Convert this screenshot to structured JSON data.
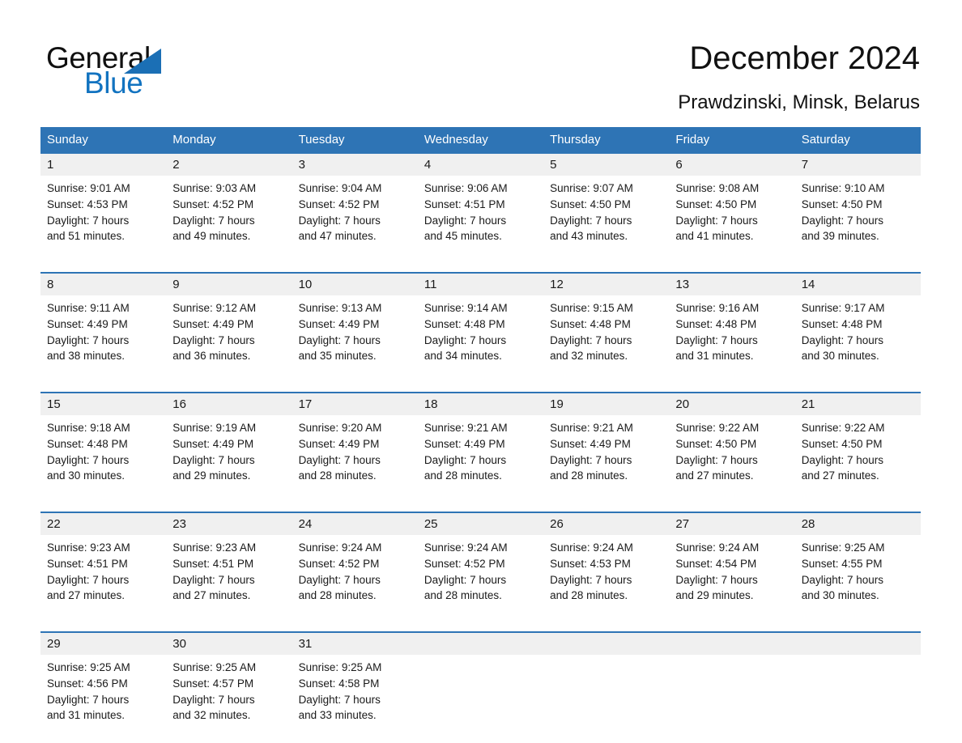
{
  "brand": {
    "name_part1": "General",
    "name_part2": "Blue",
    "triangle_icon": "blue-triangle-icon",
    "accent_color": "#1b6fb5"
  },
  "header": {
    "title": "December 2024",
    "subtitle": "Prawdzinski, Minsk, Belarus"
  },
  "theme": {
    "header_bar_color": "#2e74b5",
    "date_band_color": "#f0f0f0",
    "row_divider_color": "#2e74b5",
    "text_color": "#1a1a1a"
  },
  "calendar": {
    "weekday_headers": [
      "Sunday",
      "Monday",
      "Tuesday",
      "Wednesday",
      "Thursday",
      "Friday",
      "Saturday"
    ],
    "weeks": [
      {
        "days": [
          {
            "date": "1",
            "sunrise": "Sunrise: 9:01 AM",
            "sunset": "Sunset: 4:53 PM",
            "daylight_line1": "Daylight: 7 hours",
            "daylight_line2": "and 51 minutes."
          },
          {
            "date": "2",
            "sunrise": "Sunrise: 9:03 AM",
            "sunset": "Sunset: 4:52 PM",
            "daylight_line1": "Daylight: 7 hours",
            "daylight_line2": "and 49 minutes."
          },
          {
            "date": "3",
            "sunrise": "Sunrise: 9:04 AM",
            "sunset": "Sunset: 4:52 PM",
            "daylight_line1": "Daylight: 7 hours",
            "daylight_line2": "and 47 minutes."
          },
          {
            "date": "4",
            "sunrise": "Sunrise: 9:06 AM",
            "sunset": "Sunset: 4:51 PM",
            "daylight_line1": "Daylight: 7 hours",
            "daylight_line2": "and 45 minutes."
          },
          {
            "date": "5",
            "sunrise": "Sunrise: 9:07 AM",
            "sunset": "Sunset: 4:50 PM",
            "daylight_line1": "Daylight: 7 hours",
            "daylight_line2": "and 43 minutes."
          },
          {
            "date": "6",
            "sunrise": "Sunrise: 9:08 AM",
            "sunset": "Sunset: 4:50 PM",
            "daylight_line1": "Daylight: 7 hours",
            "daylight_line2": "and 41 minutes."
          },
          {
            "date": "7",
            "sunrise": "Sunrise: 9:10 AM",
            "sunset": "Sunset: 4:50 PM",
            "daylight_line1": "Daylight: 7 hours",
            "daylight_line2": "and 39 minutes."
          }
        ]
      },
      {
        "days": [
          {
            "date": "8",
            "sunrise": "Sunrise: 9:11 AM",
            "sunset": "Sunset: 4:49 PM",
            "daylight_line1": "Daylight: 7 hours",
            "daylight_line2": "and 38 minutes."
          },
          {
            "date": "9",
            "sunrise": "Sunrise: 9:12 AM",
            "sunset": "Sunset: 4:49 PM",
            "daylight_line1": "Daylight: 7 hours",
            "daylight_line2": "and 36 minutes."
          },
          {
            "date": "10",
            "sunrise": "Sunrise: 9:13 AM",
            "sunset": "Sunset: 4:49 PM",
            "daylight_line1": "Daylight: 7 hours",
            "daylight_line2": "and 35 minutes."
          },
          {
            "date": "11",
            "sunrise": "Sunrise: 9:14 AM",
            "sunset": "Sunset: 4:48 PM",
            "daylight_line1": "Daylight: 7 hours",
            "daylight_line2": "and 34 minutes."
          },
          {
            "date": "12",
            "sunrise": "Sunrise: 9:15 AM",
            "sunset": "Sunset: 4:48 PM",
            "daylight_line1": "Daylight: 7 hours",
            "daylight_line2": "and 32 minutes."
          },
          {
            "date": "13",
            "sunrise": "Sunrise: 9:16 AM",
            "sunset": "Sunset: 4:48 PM",
            "daylight_line1": "Daylight: 7 hours",
            "daylight_line2": "and 31 minutes."
          },
          {
            "date": "14",
            "sunrise": "Sunrise: 9:17 AM",
            "sunset": "Sunset: 4:48 PM",
            "daylight_line1": "Daylight: 7 hours",
            "daylight_line2": "and 30 minutes."
          }
        ]
      },
      {
        "days": [
          {
            "date": "15",
            "sunrise": "Sunrise: 9:18 AM",
            "sunset": "Sunset: 4:48 PM",
            "daylight_line1": "Daylight: 7 hours",
            "daylight_line2": "and 30 minutes."
          },
          {
            "date": "16",
            "sunrise": "Sunrise: 9:19 AM",
            "sunset": "Sunset: 4:49 PM",
            "daylight_line1": "Daylight: 7 hours",
            "daylight_line2": "and 29 minutes."
          },
          {
            "date": "17",
            "sunrise": "Sunrise: 9:20 AM",
            "sunset": "Sunset: 4:49 PM",
            "daylight_line1": "Daylight: 7 hours",
            "daylight_line2": "and 28 minutes."
          },
          {
            "date": "18",
            "sunrise": "Sunrise: 9:21 AM",
            "sunset": "Sunset: 4:49 PM",
            "daylight_line1": "Daylight: 7 hours",
            "daylight_line2": "and 28 minutes."
          },
          {
            "date": "19",
            "sunrise": "Sunrise: 9:21 AM",
            "sunset": "Sunset: 4:49 PM",
            "daylight_line1": "Daylight: 7 hours",
            "daylight_line2": "and 28 minutes."
          },
          {
            "date": "20",
            "sunrise": "Sunrise: 9:22 AM",
            "sunset": "Sunset: 4:50 PM",
            "daylight_line1": "Daylight: 7 hours",
            "daylight_line2": "and 27 minutes."
          },
          {
            "date": "21",
            "sunrise": "Sunrise: 9:22 AM",
            "sunset": "Sunset: 4:50 PM",
            "daylight_line1": "Daylight: 7 hours",
            "daylight_line2": "and 27 minutes."
          }
        ]
      },
      {
        "days": [
          {
            "date": "22",
            "sunrise": "Sunrise: 9:23 AM",
            "sunset": "Sunset: 4:51 PM",
            "daylight_line1": "Daylight: 7 hours",
            "daylight_line2": "and 27 minutes."
          },
          {
            "date": "23",
            "sunrise": "Sunrise: 9:23 AM",
            "sunset": "Sunset: 4:51 PM",
            "daylight_line1": "Daylight: 7 hours",
            "daylight_line2": "and 27 minutes."
          },
          {
            "date": "24",
            "sunrise": "Sunrise: 9:24 AM",
            "sunset": "Sunset: 4:52 PM",
            "daylight_line1": "Daylight: 7 hours",
            "daylight_line2": "and 28 minutes."
          },
          {
            "date": "25",
            "sunrise": "Sunrise: 9:24 AM",
            "sunset": "Sunset: 4:52 PM",
            "daylight_line1": "Daylight: 7 hours",
            "daylight_line2": "and 28 minutes."
          },
          {
            "date": "26",
            "sunrise": "Sunrise: 9:24 AM",
            "sunset": "Sunset: 4:53 PM",
            "daylight_line1": "Daylight: 7 hours",
            "daylight_line2": "and 28 minutes."
          },
          {
            "date": "27",
            "sunrise": "Sunrise: 9:24 AM",
            "sunset": "Sunset: 4:54 PM",
            "daylight_line1": "Daylight: 7 hours",
            "daylight_line2": "and 29 minutes."
          },
          {
            "date": "28",
            "sunrise": "Sunrise: 9:25 AM",
            "sunset": "Sunset: 4:55 PM",
            "daylight_line1": "Daylight: 7 hours",
            "daylight_line2": "and 30 minutes."
          }
        ]
      },
      {
        "days": [
          {
            "date": "29",
            "sunrise": "Sunrise: 9:25 AM",
            "sunset": "Sunset: 4:56 PM",
            "daylight_line1": "Daylight: 7 hours",
            "daylight_line2": "and 31 minutes."
          },
          {
            "date": "30",
            "sunrise": "Sunrise: 9:25 AM",
            "sunset": "Sunset: 4:57 PM",
            "daylight_line1": "Daylight: 7 hours",
            "daylight_line2": "and 32 minutes."
          },
          {
            "date": "31",
            "sunrise": "Sunrise: 9:25 AM",
            "sunset": "Sunset: 4:58 PM",
            "daylight_line1": "Daylight: 7 hours",
            "daylight_line2": "and 33 minutes."
          },
          {
            "date": "",
            "sunrise": "",
            "sunset": "",
            "daylight_line1": "",
            "daylight_line2": ""
          },
          {
            "date": "",
            "sunrise": "",
            "sunset": "",
            "daylight_line1": "",
            "daylight_line2": ""
          },
          {
            "date": "",
            "sunrise": "",
            "sunset": "",
            "daylight_line1": "",
            "daylight_line2": ""
          },
          {
            "date": "",
            "sunrise": "",
            "sunset": "",
            "daylight_line1": "",
            "daylight_line2": ""
          }
        ]
      }
    ]
  }
}
